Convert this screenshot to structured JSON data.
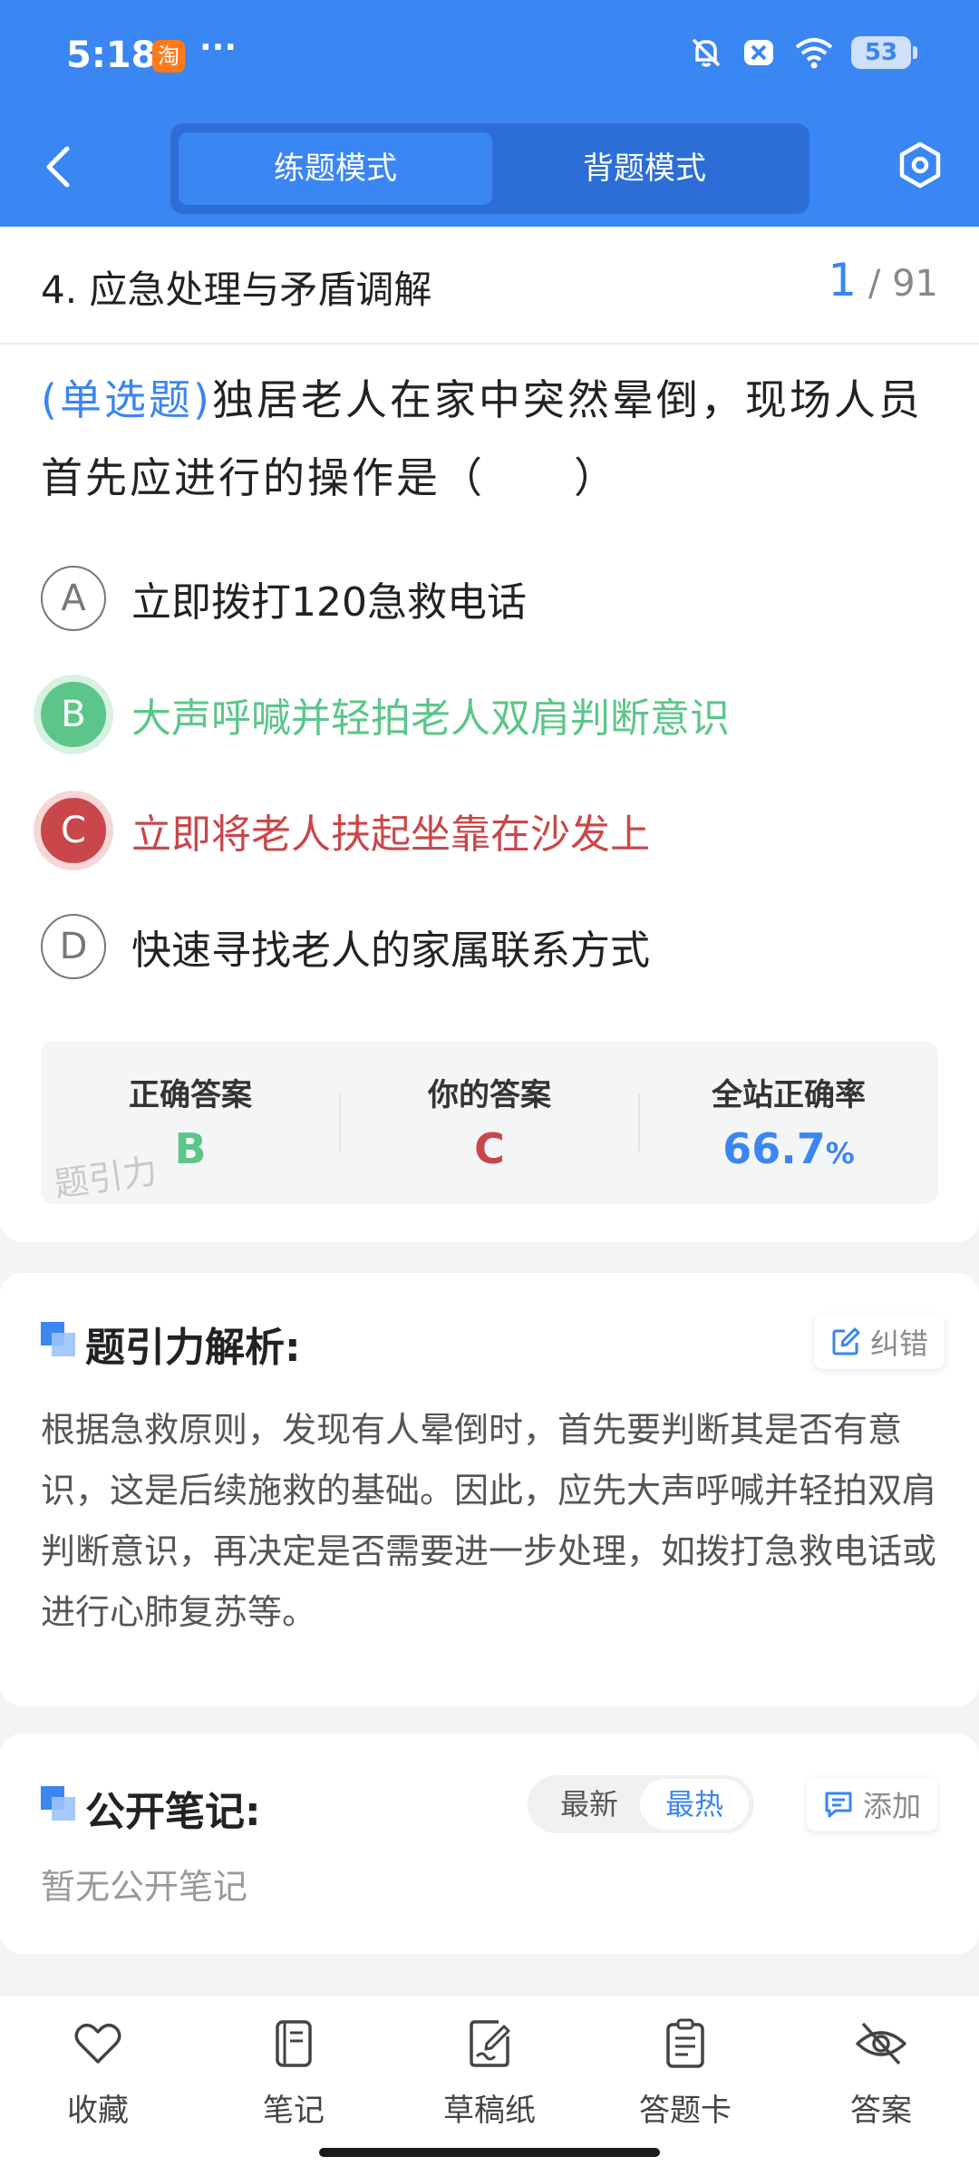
{
  "status_bar": {
    "time": "5:18",
    "more": "···",
    "battery": "53",
    "app_badge": "淘"
  },
  "header": {
    "tabs": [
      {
        "label": "练题模式",
        "active": true
      },
      {
        "label": "背题模式",
        "active": false
      }
    ]
  },
  "question": {
    "chapter": "4. 应急处理与矛盾调解",
    "current": "1",
    "total": "/ 91",
    "type": "(单选题)",
    "text": "独居老人在家中突然晕倒，现场人员首先应进行的操作是（　　）",
    "options": [
      {
        "letter": "A",
        "text": "立即拨打120急救电话",
        "state": "normal"
      },
      {
        "letter": "B",
        "text": "大声呼喊并轻拍老人双肩判断意识",
        "state": "correct"
      },
      {
        "letter": "C",
        "text": "立即将老人扶起坐靠在沙发上",
        "state": "wrong"
      },
      {
        "letter": "D",
        "text": "快速寻找老人的家属联系方式",
        "state": "normal"
      }
    ]
  },
  "answer_summary": {
    "correct_label": "正确答案",
    "correct_value": "B",
    "yours_label": "你的答案",
    "yours_value": "C",
    "rate_label": "全站正确率",
    "rate_value": "66.7",
    "rate_unit": "%",
    "watermark": "题引力"
  },
  "analysis": {
    "title": "题引力解析:",
    "correct_button": "纠错",
    "text": "根据急救原则，发现有人晕倒时，首先要判断其是否有意识，这是后续施救的基础。因此，应先大声呼喊并轻拍双肩判断意识，再决定是否需要进一步处理，如拨打急救电话或进行心肺复苏等。"
  },
  "notes": {
    "title": "公开笔记:",
    "sort": [
      {
        "label": "最新",
        "active": false
      },
      {
        "label": "最热",
        "active": true
      }
    ],
    "add_button": "添加",
    "empty_text": "暂无公开笔记"
  },
  "bottom_nav": {
    "items": [
      {
        "label": "收藏",
        "icon": "heart-icon"
      },
      {
        "label": "笔记",
        "icon": "notebook-icon"
      },
      {
        "label": "草稿纸",
        "icon": "draft-icon"
      },
      {
        "label": "答题卡",
        "icon": "answer-card-icon"
      },
      {
        "label": "答案",
        "icon": "eye-off-icon"
      }
    ]
  },
  "colors": {
    "brand": "#3a86f2",
    "correct": "#5cc68a",
    "wrong": "#c9474a"
  }
}
